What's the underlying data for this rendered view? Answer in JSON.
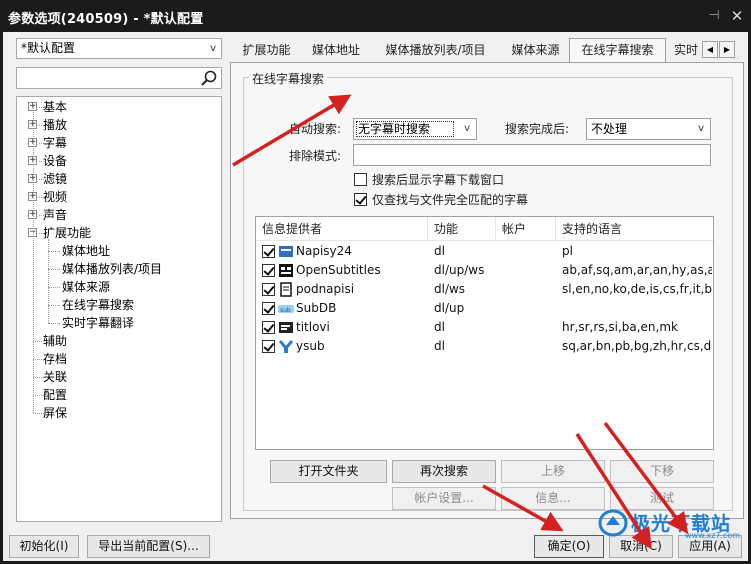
{
  "window": {
    "title": "参数选项(240509) - *默认配置",
    "pin_glyph": "⊣",
    "close_glyph": "✕"
  },
  "left": {
    "profile": "*默认配置",
    "search_value": "",
    "tree": [
      {
        "label": "基本",
        "expand": "+"
      },
      {
        "label": "播放",
        "expand": "+"
      },
      {
        "label": "字幕",
        "expand": "+"
      },
      {
        "label": "设备",
        "expand": "+"
      },
      {
        "label": "滤镜",
        "expand": "+"
      },
      {
        "label": "视频",
        "expand": "+"
      },
      {
        "label": "声音",
        "expand": "+"
      },
      {
        "label": "扩展功能",
        "expand": "−"
      },
      {
        "label": "媒体地址"
      },
      {
        "label": "媒体播放列表/项目"
      },
      {
        "label": "媒体来源"
      },
      {
        "label": "在线字幕搜索",
        "selected": true
      },
      {
        "label": "实时字幕翻译"
      },
      {
        "label": "辅助"
      },
      {
        "label": "存档"
      },
      {
        "label": "关联"
      },
      {
        "label": "配置"
      },
      {
        "label": "屏保"
      }
    ]
  },
  "tabs": [
    {
      "label": "扩展功能"
    },
    {
      "label": "媒体地址"
    },
    {
      "label": "媒体播放列表/项目"
    },
    {
      "label": "媒体来源"
    },
    {
      "label": "在线字幕搜索",
      "active": true
    },
    {
      "label": "实时"
    }
  ],
  "tab_scroll": {
    "left": "◀",
    "right": "▶"
  },
  "group": {
    "title": "在线字幕搜索",
    "auto_search_label": "自动搜索:",
    "auto_search_value": "无字幕时搜索",
    "after_search_label": "搜索完成后:",
    "after_search_value": "不处理",
    "exclude_label": "排除模式:",
    "exclude_value": "",
    "show_window_label": "搜索后显示字幕下载窗口",
    "show_window_checked": false,
    "exact_match_label": "仅查找与文件完全匹配的字幕",
    "exact_match_checked": true
  },
  "providers": {
    "columns": [
      "信息提供者",
      "功能",
      "帐户",
      "支持的语言"
    ],
    "rows": [
      {
        "name": "Napisy24",
        "features": "dl",
        "account": "",
        "langs": "pl",
        "checked": true,
        "icon": "napisy24-icon"
      },
      {
        "name": "OpenSubtitles",
        "features": "dl/up/ws",
        "account": "",
        "langs": "ab,af,sq,am,ar,an,hy,as,a...",
        "checked": true,
        "icon": "opensubtitles-icon"
      },
      {
        "name": "podnapisi",
        "features": "dl/ws",
        "account": "",
        "langs": "sl,en,no,ko,de,is,cs,fr,it,b...",
        "checked": true,
        "icon": "podnapisi-icon"
      },
      {
        "name": "SubDB",
        "features": "dl/up",
        "account": "",
        "langs": "",
        "checked": true,
        "icon": "subdb-icon"
      },
      {
        "name": "titlovi",
        "features": "dl",
        "account": "",
        "langs": "hr,sr,rs,si,ba,en,mk",
        "checked": true,
        "icon": "titlovi-icon"
      },
      {
        "name": "ysub",
        "features": "dl",
        "account": "",
        "langs": "sq,ar,bn,pb,bg,zh,hr,cs,d...",
        "checked": true,
        "icon": "ysub-icon"
      }
    ]
  },
  "buttons": {
    "open_folder": "打开文件夹",
    "search_again": "再次搜索",
    "move_up": "上移",
    "move_down": "下移",
    "account_settings": "帐户设置...",
    "info": "信息...",
    "test": "测试"
  },
  "footer": {
    "init": "初始化(I)",
    "export": "导出当前配置(S)...",
    "ok": "确定(O)",
    "cancel": "取消(C)",
    "apply": "应用(A)"
  },
  "watermark": {
    "text": "极光下载站",
    "sub": "www.xz7.com"
  },
  "colors": {
    "annotation_arrow": "#d42020",
    "watermark": "#1f7fd6"
  }
}
